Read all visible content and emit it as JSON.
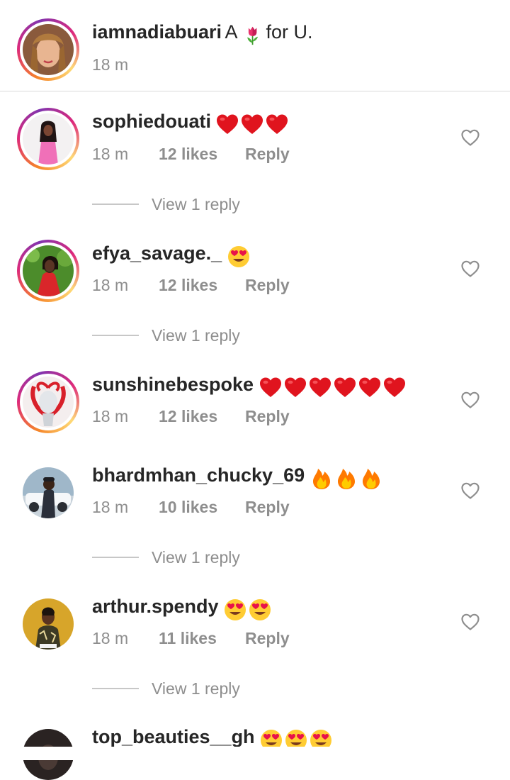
{
  "caption": {
    "username": "iamnadiabuari",
    "text_before": "A",
    "text_after": "for U.",
    "time": "18 m",
    "emoji_icon": "tulip-icon"
  },
  "comments": [
    {
      "username": "sophiedouati",
      "emojis": [
        "red-heart-icon",
        "red-heart-icon",
        "red-heart-icon"
      ],
      "time": "18 m",
      "likes": "12 likes",
      "reply": "Reply",
      "view_replies": "View 1 reply"
    },
    {
      "username": "efya_savage._",
      "emojis": [
        "heart-eyes-icon"
      ],
      "time": "18 m",
      "likes": "12 likes",
      "reply": "Reply",
      "view_replies": "View 1 reply"
    },
    {
      "username": "sunshinebespoke",
      "emojis": [
        "red-heart-icon",
        "red-heart-icon",
        "red-heart-icon",
        "red-heart-icon",
        "red-heart-icon",
        "red-heart-icon"
      ],
      "time": "18 m",
      "likes": "12 likes",
      "reply": "Reply"
    },
    {
      "username": "bhardmhan_chucky_69",
      "emojis": [
        "fire-icon",
        "fire-icon",
        "fire-icon"
      ],
      "time": "18 m",
      "likes": "10 likes",
      "reply": "Reply",
      "view_replies": "View 1 reply"
    },
    {
      "username": "arthur.spendy",
      "emojis": [
        "heart-eyes-icon",
        "heart-eyes-icon"
      ],
      "time": "18 m",
      "likes": "11 likes",
      "reply": "Reply",
      "view_replies": "View 1 reply"
    },
    {
      "username": "top_beauties__gh",
      "emojis": [
        "heart-eyes-icon",
        "heart-eyes-icon",
        "heart-eyes-icon"
      ]
    }
  ]
}
